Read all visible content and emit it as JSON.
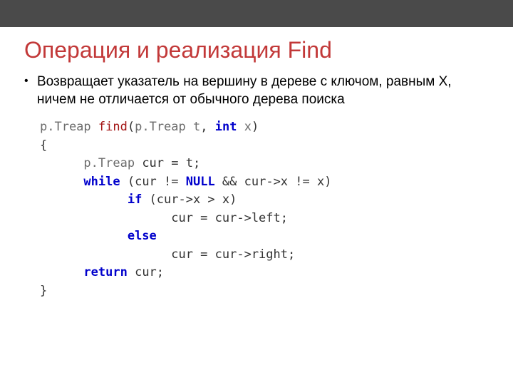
{
  "title": "Операция и реализация Find",
  "bullet": "Возвращает указатель на вершину в дереве с ключом, равным X, ничем не отличается от обычного дерева поиска",
  "code": {
    "l1_type": "p.Treap",
    "l1_func": "find",
    "l1_paren_open": "(",
    "l1_param_type": "p.Treap",
    "l1_param_name": " t",
    "l1_comma": ", ",
    "l1_int": "int",
    "l1_x": " x",
    "l1_paren_close": ")",
    "l2": "{",
    "l3_type": "p.Treap",
    "l3_rest": " cur = t;",
    "l4_while": "while",
    "l4_open": " (cur != ",
    "l4_null": "NULL",
    "l4_rest": " && cur->x != x)",
    "l5_if": "if",
    "l5_rest": " (cur->x > x)",
    "l6": "cur = cur->left;",
    "l7_else": "else",
    "l8": "cur = cur->right;",
    "l9_return": "return",
    "l9_rest": " cur;",
    "l10": "}"
  }
}
